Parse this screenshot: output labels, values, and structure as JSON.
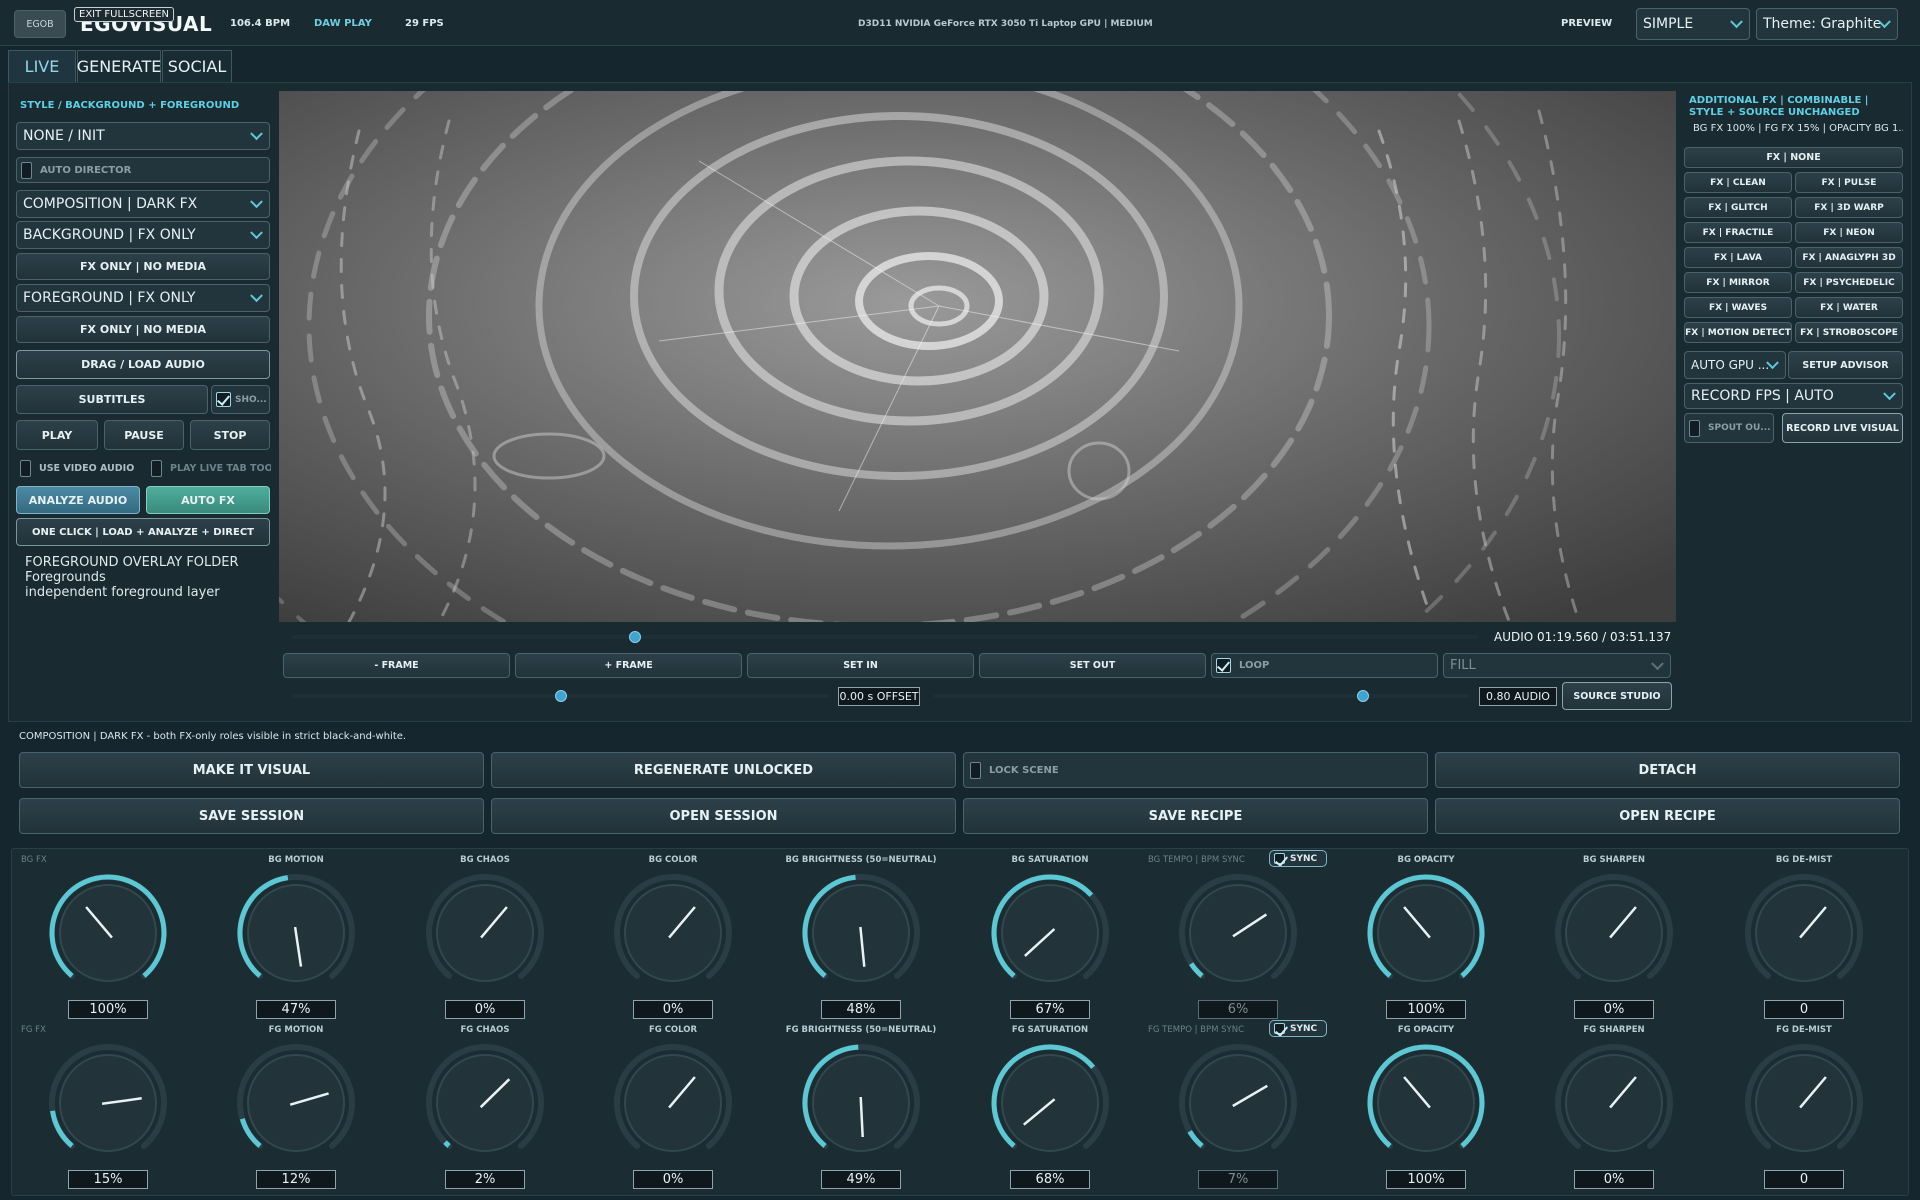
{
  "topbar": {
    "logo_badge": "EGOB",
    "tooltip": "EXIT FULLSCREEN",
    "app_title": "EGOVISUAL",
    "bpm": "106.4 BPM",
    "daw": "DAW PLAY",
    "fps": "29 FPS",
    "gpu": "D3D11  NVIDIA GeForce RTX 3050 Ti Laptop GPU | MEDIUM",
    "preview_label": "PREVIEW",
    "mode": "SIMPLE",
    "theme": "Theme: Graphite"
  },
  "tabs": [
    {
      "label": "LIVE"
    },
    {
      "label": "GENERATE"
    },
    {
      "label": "SOCIAL"
    }
  ],
  "left": {
    "heading": "STYLE / BACKGROUND + FOREGROUND",
    "preset": "NONE / INIT",
    "auto_director": "AUTO DIRECTOR",
    "composition": "COMPOSITION | DARK FX",
    "background": "BACKGROUND | FX ONLY",
    "bg_media": "FX ONLY | NO MEDIA",
    "foreground": "FOREGROUND | FX ONLY",
    "fg_media": "FX ONLY | NO MEDIA",
    "load_audio": "DRAG / LOAD AUDIO",
    "subtitles": "SUBTITLES",
    "show": "SHO...",
    "play": "PLAY",
    "pause": "PAUSE",
    "stop": "STOP",
    "use_video_audio": "USE VIDEO AUDIO",
    "play_live_tab": "PLAY LIVE TAB TOO",
    "analyze": "ANALYZE AUDIO",
    "auto_fx": "AUTO FX",
    "one_click": "ONE CLICK | LOAD + ANALYZE + DIRECT",
    "overlay_title": "FOREGROUND OVERLAY FOLDER",
    "overlay_name": "Foregrounds",
    "overlay_desc": "independent foreground layer"
  },
  "transport": {
    "audio_time": "AUDIO 01:19.560 / 03:51.137",
    "progress": 0.29,
    "minus_frame": "- FRAME",
    "plus_frame": "+ FRAME",
    "set_in": "SET IN",
    "set_out": "SET OUT",
    "loop": "LOOP",
    "fill": "FILL",
    "offset_value": 0.5,
    "offset_label": "0.00 s OFFSET",
    "audio_value": 0.8,
    "audio_label": "0.80 AUDIO",
    "source_studio": "SOURCE STUDIO"
  },
  "right": {
    "heading": "ADDITIONAL FX | COMBINABLE | STYLE + SOURCE UNCHANGED",
    "summary": "BG FX 100%  | FG FX 15%  | OPACITY BG 1...",
    "fx_none": "FX | NONE",
    "fx_buttons": [
      "FX | CLEAN",
      "FX | PULSE",
      "FX | GLITCH",
      "FX | 3D WARP",
      "FX | FRACTILE",
      "FX | NEON",
      "FX | LAVA",
      "FX | ANAGLYPH 3D",
      "FX | MIRROR",
      "FX | PSYCHEDELIC",
      "FX | WAVES",
      "FX | WATER",
      "FX | MOTION DETECT",
      "FX | STROBOSCOPE"
    ],
    "auto_gpu": "AUTO GPU ...",
    "setup_advisor": "SETUP ADVISOR",
    "record_fps": "RECORD FPS | AUTO",
    "spout": "SPOUT OU...",
    "record_live": "RECORD LIVE VISUAL"
  },
  "status_line": "COMPOSITION | DARK FX - both FX-only roles visible in strict black-and-white.",
  "actions": {
    "make_visual": "MAKE IT VISUAL",
    "regenerate": "REGENERATE UNLOCKED",
    "lock_scene": "LOCK SCENE",
    "detach": "DETACH",
    "save_session": "SAVE SESSION",
    "open_session": "OPEN SESSION",
    "save_recipe": "SAVE RECIPE",
    "open_recipe": "OPEN RECIPE"
  },
  "sync_label": "SYNC",
  "knobs_bg": [
    {
      "label": "BG FX",
      "value": "100%",
      "level": 1.0,
      "dim": true
    },
    {
      "label": "BG MOTION",
      "value": "47%",
      "level": 0.47
    },
    {
      "label": "BG CHAOS",
      "value": "0%",
      "level": 0.0
    },
    {
      "label": "BG COLOR",
      "value": "0%",
      "level": 0.0
    },
    {
      "label": "BG BRIGHTNESS (50=NEUTRAL)",
      "value": "48%",
      "level": 0.48
    },
    {
      "label": "BG SATURATION",
      "value": "67%",
      "level": 0.67
    },
    {
      "label": "BG TEMPO | BPM SYNC",
      "value": "6%",
      "level": 0.06,
      "dim": true,
      "tempo": true
    },
    {
      "label": "BG OPACITY",
      "value": "100%",
      "level": 1.0
    },
    {
      "label": "BG SHARPEN",
      "value": "0%",
      "level": 0.0
    },
    {
      "label": "BG DE-MIST",
      "value": "0",
      "level": 0.0
    }
  ],
  "knobs_fg": [
    {
      "label": "FG FX",
      "value": "15%",
      "level": 0.15,
      "dim": true
    },
    {
      "label": "FG MOTION",
      "value": "12%",
      "level": 0.12
    },
    {
      "label": "FG CHAOS",
      "value": "2%",
      "level": 0.02
    },
    {
      "label": "FG COLOR",
      "value": "0%",
      "level": 0.0
    },
    {
      "label": "FG BRIGHTNESS (50=NEUTRAL)",
      "value": "49%",
      "level": 0.49
    },
    {
      "label": "FG SATURATION",
      "value": "68%",
      "level": 0.68
    },
    {
      "label": "FG TEMPO | BPM SYNC",
      "value": "7%",
      "level": 0.07,
      "dim": true,
      "tempo": true
    },
    {
      "label": "FG OPACITY",
      "value": "100%",
      "level": 1.0
    },
    {
      "label": "FG SHARPEN",
      "value": "0%",
      "level": 0.0
    },
    {
      "label": "FG DE-MIST",
      "value": "0",
      "level": 0.0
    }
  ]
}
